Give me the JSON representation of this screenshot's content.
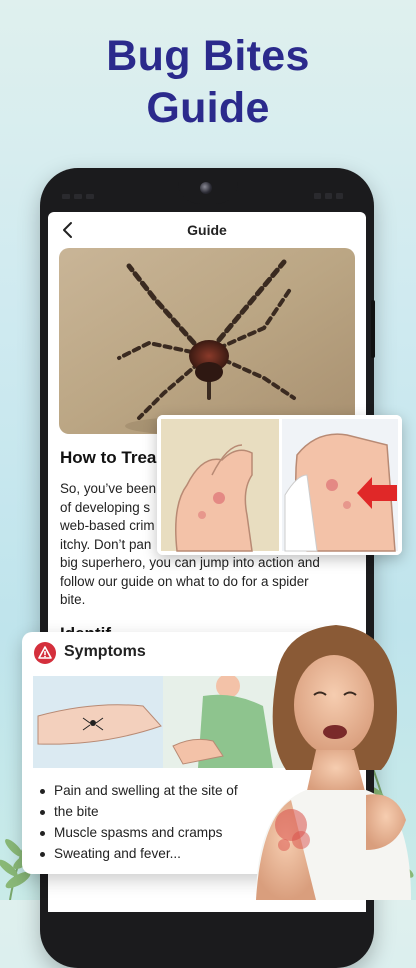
{
  "headline": {
    "line1": "Bug Bites",
    "line2": "Guide"
  },
  "appbar": {
    "title": "Guide",
    "back_icon": "chevron-left-icon"
  },
  "article": {
    "title": "How to Trea",
    "body": "So, you’ve been... of developing s... web-based crim... itchy. Don’t pan... big superhero, you can jump into action and follow our guide on what to do for a spider bite.",
    "lines": [
      "So, you’ve been",
      "of developing s",
      "web-based crim",
      "itchy. Don’t pan",
      "big superhero, you can jump into action and",
      "follow our guide on what to do for a spider",
      "bite."
    ],
    "next_section": "Identif..."
  },
  "symptoms_card": {
    "title": "Symptoms",
    "icon": "warning-icon",
    "items": [
      "Pain and swelling at the site of",
      "the bite",
      "Muscle spasms and cramps",
      "Sweating and fever..."
    ]
  },
  "colors": {
    "headline": "#2b2a8c",
    "warning": "#d42f3c",
    "background": "#cfeaf0"
  }
}
